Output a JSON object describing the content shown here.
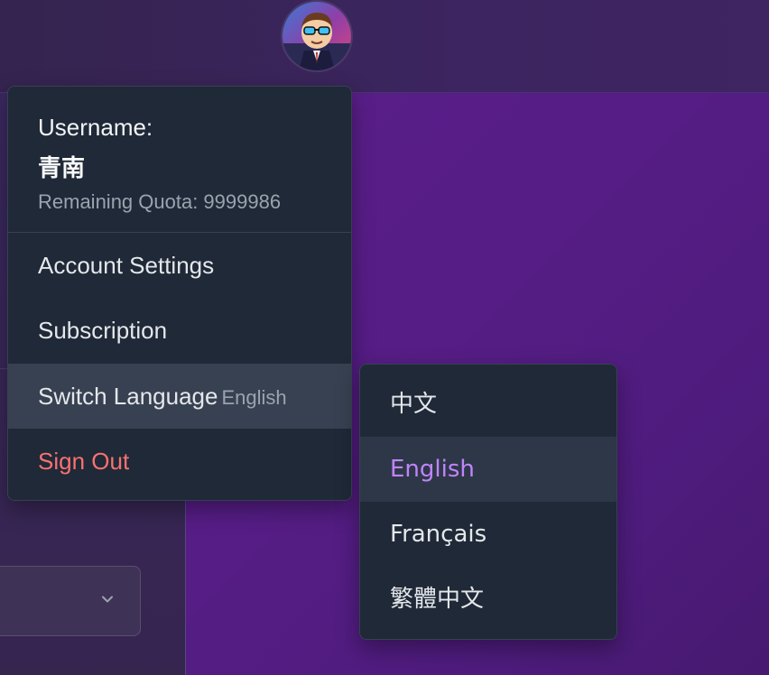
{
  "user_menu": {
    "username_label": "Username:",
    "username": "青南",
    "quota_text": "Remaining Quota: 9999986",
    "items": {
      "account_settings": "Account Settings",
      "subscription": "Subscription",
      "switch_language": "Switch Language",
      "current_language": "English",
      "sign_out": "Sign Out"
    }
  },
  "language_menu": {
    "options": [
      "中文",
      "English",
      "Français",
      "繁體中文"
    ],
    "selected": "English"
  },
  "icons": {
    "avatar": "user-avatar-cartoon",
    "select_chevron": "chevron-down-icon"
  },
  "colors": {
    "menu_bg": "#1f2937",
    "active_bg": "#374151",
    "sign_out": "#f87171",
    "selected_language": "#c084fc",
    "main_bg": "#561d86"
  }
}
